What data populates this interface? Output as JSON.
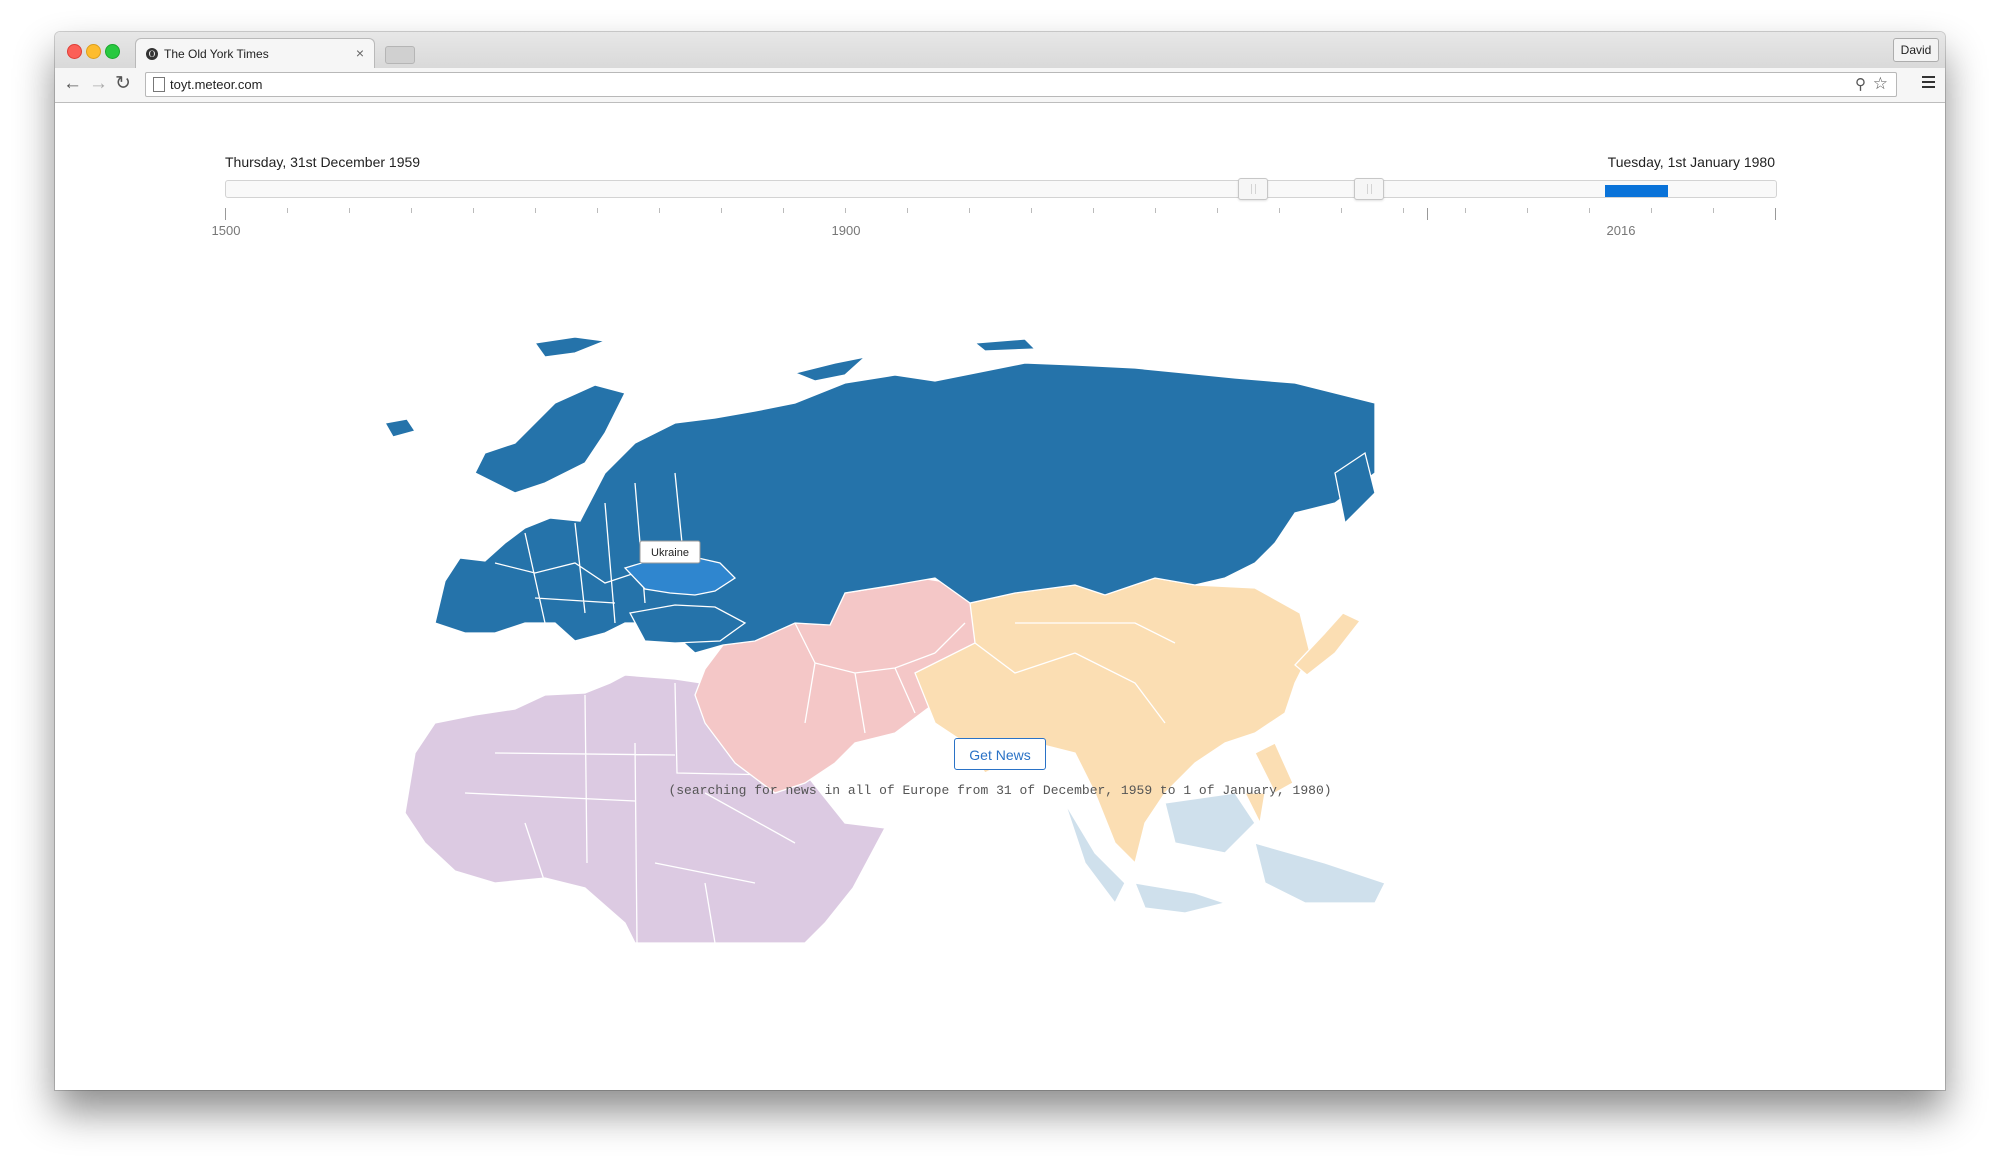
{
  "browser": {
    "tab_title": "The Old York Times",
    "tab_close": "×",
    "favicon_letter": "O",
    "profile_name": "David",
    "url": "toyt.meteor.com",
    "icons": {
      "back": "back-arrow-icon",
      "forward": "forward-arrow-icon",
      "reload": "reload-icon",
      "search": "search-icon",
      "star": "star-icon",
      "menu": "menu-icon"
    },
    "back_glyph": "←",
    "forward_glyph": "→",
    "reload_glyph": "↻",
    "search_glyph": "⚲",
    "star_glyph": "☆"
  },
  "slider": {
    "start_date": "Thursday, 31st December 1959",
    "end_date": "Tuesday, 1st January 1980",
    "min_year": 1500,
    "max_year": 2016,
    "tick_labels": [
      "1500",
      "1900",
      "2016"
    ],
    "selected_range": [
      1959,
      1980
    ],
    "range_color": "#0a73d9"
  },
  "map": {
    "hover_label": "Ukraine",
    "selected_region": "Europe",
    "colors": {
      "europe": "#2573aa",
      "ukraine_hover": "#2f86cf",
      "middle_east_central_asia": "#f4c7c7",
      "east_south_asia": "#fbdeb3",
      "africa": "#dccae2",
      "oceania": "#cfe0ec",
      "borders": "#ffffff"
    }
  },
  "actions": {
    "get_news_label": "Get News"
  },
  "status": {
    "search_text": "(searching for news in all of Europe from 31 of December, 1959 to 1 of January, 1980)"
  }
}
